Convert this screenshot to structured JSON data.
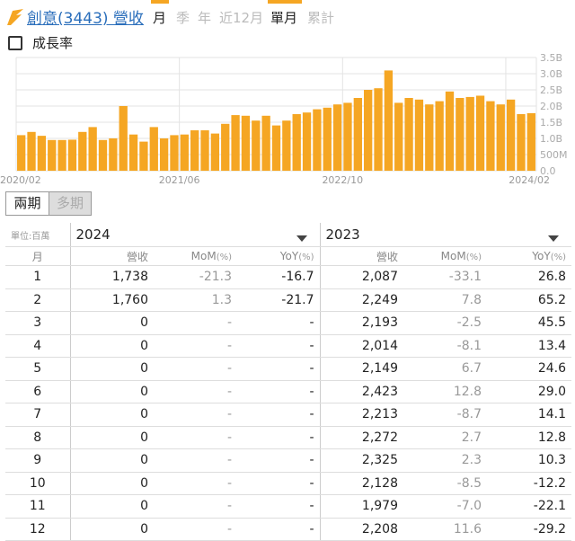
{
  "header": {
    "title": "創意(3443) 營收",
    "tabs": [
      {
        "label": "月",
        "active": true
      },
      {
        "label": "季",
        "active": false
      },
      {
        "label": "年",
        "active": false
      },
      {
        "label": "近12月",
        "active": false
      },
      {
        "label": "單月",
        "active": true
      },
      {
        "label": "累計",
        "active": false
      }
    ]
  },
  "growth_toggle": {
    "label": "成長率",
    "checked": false
  },
  "period_buttons": [
    {
      "label": "兩期",
      "selected": true
    },
    {
      "label": "多期",
      "selected": false
    }
  ],
  "colors": {
    "bar": "#f5a623",
    "accent": "#f5a623",
    "link": "#2a6ebb"
  },
  "chart_data": {
    "type": "bar",
    "x_tick_labels": [
      "2020/02",
      "2021/06",
      "2022/10",
      "2024/02"
    ],
    "y_tick_labels": [
      "0.0",
      "500M",
      "1.0B",
      "1.5B",
      "2.0B",
      "2.5B",
      "3.0B",
      "3.5B"
    ],
    "ylim": [
      0,
      3.5
    ],
    "y_unit": "B",
    "grid": true,
    "values": [
      1.1,
      1.2,
      1.08,
      0.95,
      0.95,
      0.96,
      1.2,
      1.35,
      0.95,
      1.0,
      2.0,
      1.12,
      0.9,
      1.35,
      1.0,
      1.1,
      1.12,
      1.25,
      1.25,
      1.15,
      1.45,
      1.72,
      1.7,
      1.55,
      1.7,
      1.4,
      1.55,
      1.75,
      1.8,
      1.9,
      1.95,
      2.05,
      2.1,
      2.25,
      2.5,
      2.55,
      3.1,
      2.1,
      2.25,
      2.2,
      2.05,
      2.15,
      2.45,
      2.25,
      2.28,
      2.32,
      2.15,
      2.05,
      2.2,
      1.75,
      1.78
    ]
  },
  "table": {
    "unit_label": "單位:百萬",
    "years": [
      "2024",
      "2023"
    ],
    "col_headers": {
      "month": "月",
      "revenue": "營收",
      "mom": "MoM",
      "yoy": "YoY",
      "pct": "(%)"
    },
    "rows": [
      [
        "1",
        "1,738",
        "-21.3",
        "-16.7",
        "2,087",
        "-33.1",
        "26.8"
      ],
      [
        "2",
        "1,760",
        "1.3",
        "-21.7",
        "2,249",
        "7.8",
        "65.2"
      ],
      [
        "3",
        "0",
        "-",
        "-",
        "2,193",
        "-2.5",
        "45.5"
      ],
      [
        "4",
        "0",
        "-",
        "-",
        "2,014",
        "-8.1",
        "13.4"
      ],
      [
        "5",
        "0",
        "-",
        "-",
        "2,149",
        "6.7",
        "24.6"
      ],
      [
        "6",
        "0",
        "-",
        "-",
        "2,423",
        "12.8",
        "29.0"
      ],
      [
        "7",
        "0",
        "-",
        "-",
        "2,213",
        "-8.7",
        "14.1"
      ],
      [
        "8",
        "0",
        "-",
        "-",
        "2,272",
        "2.7",
        "12.8"
      ],
      [
        "9",
        "0",
        "-",
        "-",
        "2,325",
        "2.3",
        "10.3"
      ],
      [
        "10",
        "0",
        "-",
        "-",
        "2,128",
        "-8.5",
        "-12.2"
      ],
      [
        "11",
        "0",
        "-",
        "-",
        "1,979",
        "-7.0",
        "-22.1"
      ],
      [
        "12",
        "0",
        "-",
        "-",
        "2,208",
        "11.6",
        "-29.2"
      ]
    ]
  }
}
